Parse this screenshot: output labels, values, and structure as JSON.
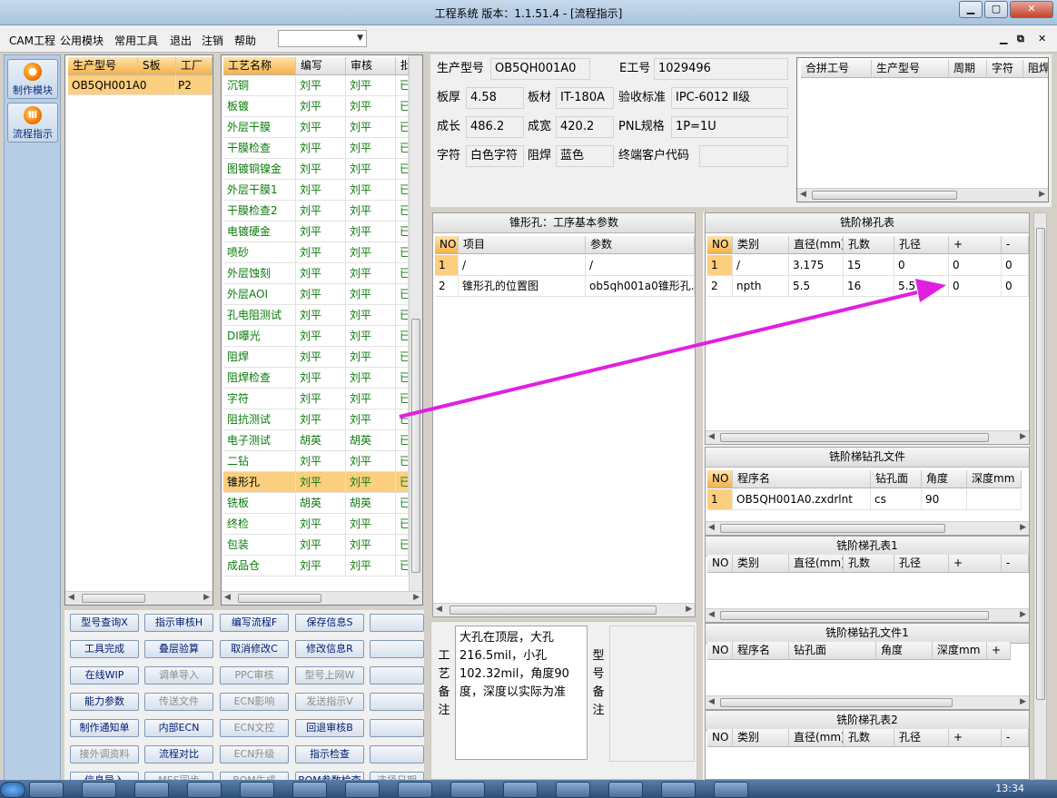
{
  "window": {
    "title": "工程系统  版本：1.1.51.4 - [流程指示]"
  },
  "menu": {
    "items": [
      "CAM工程",
      "公用模块",
      "常用工具",
      "退出",
      "注销",
      "帮助"
    ],
    "combo_value": ""
  },
  "sidebar": {
    "items": [
      {
        "label": "制作模块",
        "icon": "fire-icon"
      },
      {
        "label": "流程指示",
        "icon": "flow-icon"
      }
    ]
  },
  "model_grid": {
    "headers": [
      "生产型号",
      "S板",
      "工厂"
    ],
    "rows": [
      [
        "OB5QH001A0",
        "",
        "P2"
      ]
    ]
  },
  "process_grid": {
    "headers": [
      "工艺名称",
      "编写",
      "审核",
      "批"
    ],
    "rows": [
      [
        "沉铜",
        "刘平",
        "刘平",
        "已"
      ],
      [
        "板镀",
        "刘平",
        "刘平",
        "已"
      ],
      [
        "外层干膜",
        "刘平",
        "刘平",
        "已"
      ],
      [
        "干膜检查",
        "刘平",
        "刘平",
        "已"
      ],
      [
        "图镀铜镍金",
        "刘平",
        "刘平",
        "已"
      ],
      [
        "外层干膜1",
        "刘平",
        "刘平",
        "已"
      ],
      [
        "干膜检查2",
        "刘平",
        "刘平",
        "已"
      ],
      [
        "电镀硬金",
        "刘平",
        "刘平",
        "已"
      ],
      [
        "喷砂",
        "刘平",
        "刘平",
        "已"
      ],
      [
        "外层蚀刻",
        "刘平",
        "刘平",
        "已"
      ],
      [
        "外层AOI",
        "刘平",
        "刘平",
        "已"
      ],
      [
        "孔电阻测试",
        "刘平",
        "刘平",
        "已"
      ],
      [
        "DI曝光",
        "刘平",
        "刘平",
        "已"
      ],
      [
        "阻焊",
        "刘平",
        "刘平",
        "已"
      ],
      [
        "阻焊检查",
        "刘平",
        "刘平",
        "已"
      ],
      [
        "字符",
        "刘平",
        "刘平",
        "已"
      ],
      [
        "阻抗测试",
        "刘平",
        "刘平",
        "已"
      ],
      [
        "电子测试",
        "胡英",
        "胡英",
        "已"
      ],
      [
        "二钻",
        "刘平",
        "刘平",
        "已"
      ],
      [
        "锥形孔",
        "刘平",
        "刘平",
        "已"
      ],
      [
        "铣板",
        "胡英",
        "胡英",
        "已"
      ],
      [
        "终检",
        "刘平",
        "刘平",
        "已"
      ],
      [
        "包装",
        "刘平",
        "刘平",
        "已"
      ],
      [
        "成品仓",
        "刘平",
        "刘平",
        "已"
      ]
    ],
    "selected_index": 19
  },
  "info": {
    "prod_model_label": "生产型号",
    "prod_model": "OB5QH001A0",
    "eno_label": "E工号",
    "eno": "1029496",
    "thick_label": "板厚",
    "thick": "4.58",
    "material_label": "板材",
    "material": "IT-180A",
    "accept_label": "验收标准",
    "accept": "IPC-6012 Ⅱ级",
    "len_label": "成长",
    "len": "486.2",
    "wid_label": "成宽",
    "wid": "420.2",
    "pnl_label": "PNL规格",
    "pnl": "1P=1U",
    "char_label": "字符",
    "char": "白色字符",
    "mask_label": "阻焊",
    "mask": "蓝色",
    "cust_label": "终端客户代码",
    "cust": ""
  },
  "merge_grid": {
    "headers": [
      "合拼工号",
      "生产型号",
      "周期",
      "字符",
      "阻焊"
    ]
  },
  "cone_params": {
    "title": "锥形孔：工序基本参数",
    "headers": [
      "NO",
      "项目",
      "参数"
    ],
    "rows": [
      [
        "1",
        "/",
        "/"
      ],
      [
        "2",
        "锥形孔的位置图",
        "ob5qh001a0锥形孔."
      ]
    ]
  },
  "step_hole": {
    "title": "铣阶梯孔表",
    "headers": [
      "NO",
      "类别",
      "直径(mm)",
      "孔数",
      "孔径",
      "+",
      "-"
    ],
    "rows": [
      [
        "1",
        "/",
        "3.175",
        "15",
        "0",
        "0",
        "0"
      ],
      [
        "2",
        "npth",
        "5.5",
        "16",
        "5.5",
        "0",
        "0"
      ]
    ]
  },
  "step_drill": {
    "title": "铣阶梯钻孔文件",
    "headers": [
      "NO",
      "程序名",
      "钻孔面",
      "角度",
      "深度mm"
    ],
    "rows": [
      [
        "1",
        "OB5QH001A0.zxdrlnt",
        "cs",
        "90",
        ""
      ]
    ]
  },
  "step_hole1": {
    "title": "铣阶梯孔表1",
    "headers": [
      "NO",
      "类别",
      "直径(mm)",
      "孔数",
      "孔径",
      "+",
      "-"
    ]
  },
  "step_drill1": {
    "title": "铣阶梯钻孔文件1",
    "headers": [
      "NO",
      "程序名",
      "钻孔面",
      "角度",
      "深度mm",
      "+"
    ]
  },
  "step_hole2": {
    "title": "铣阶梯孔表2",
    "headers": [
      "NO",
      "类别",
      "直径(mm)",
      "孔数",
      "孔径",
      "+",
      "-"
    ]
  },
  "remarks": {
    "process_label": "工艺备注",
    "process_text": "大孔在顶层，大孔216.5mil，小孔102.32mil，角度90度，深度以实际为准",
    "model_label": "型号备注"
  },
  "buttons": [
    [
      "型号查询X",
      "指示审核H",
      "编写流程F",
      "保存信息S",
      ""
    ],
    [
      "工具完成",
      "叠层验算",
      "取消修改C",
      "修改信息R",
      ""
    ],
    [
      "在线WIP",
      "调单导入",
      "PPC审核",
      "型号上网W",
      ""
    ],
    [
      "能力参数",
      "传送文件",
      "ECN影响",
      "发送指示V",
      ""
    ],
    [
      "制作通知单",
      "内部ECN",
      "ECN文控",
      "回退审核B",
      ""
    ],
    [
      "接外调资料",
      "流程对比",
      "ECN升级",
      "指示检查",
      ""
    ],
    [
      "信息导入",
      "MES同步",
      "BOM生成",
      "BOM参数检查",
      "选择日期"
    ]
  ],
  "clock": "13:34",
  "colors": {
    "accent_arrow": "#e020e0",
    "selected_row": "#fbcf7f",
    "process_text": "#0b7a0b"
  }
}
